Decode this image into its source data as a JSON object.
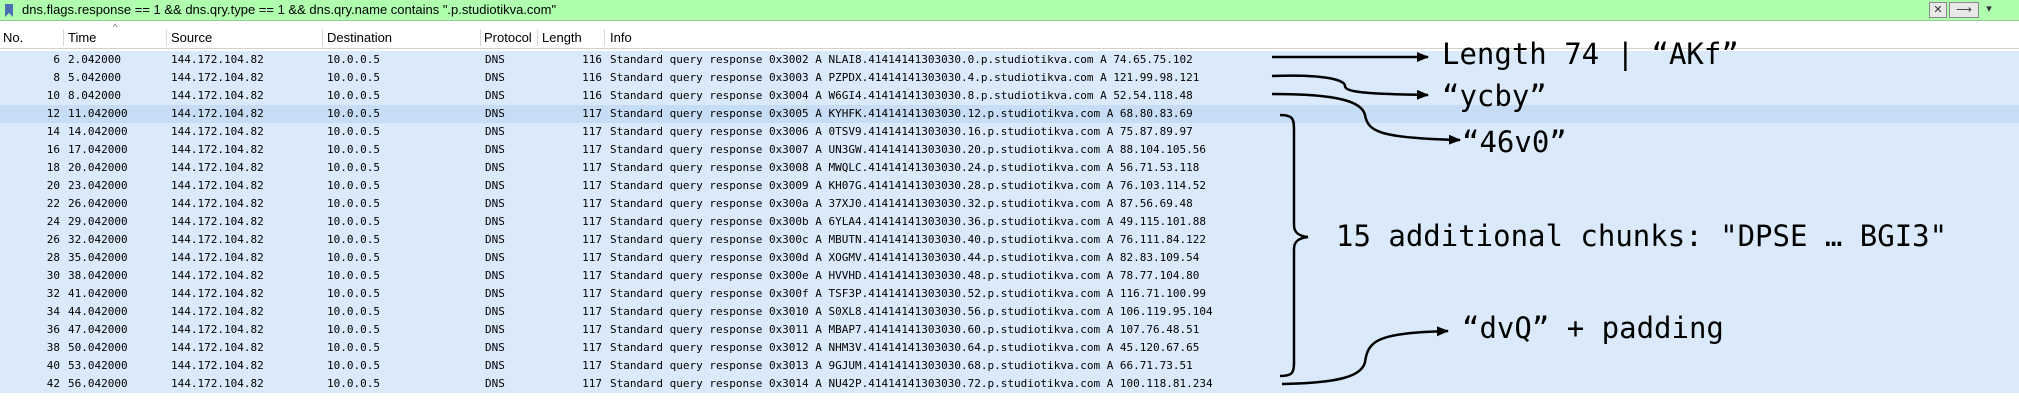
{
  "filter": {
    "text": "dns.flags.response == 1 && dns.qry.type == 1 && dns.qry.name contains \".p.studiotikva.com\"",
    "clear_glyph": "✕",
    "apply_glyph": "⟶",
    "dropdown_glyph": "▾",
    "bookmark_color": "#4a6fb5",
    "background_color": "#afffaf"
  },
  "columns": {
    "no": "No.",
    "time": "Time",
    "source": "Source",
    "destination": "Destination",
    "protocol": "Protocol",
    "length": "Length",
    "info": "Info"
  },
  "sort_indicator": "^",
  "packets": [
    {
      "no": "6",
      "time": "2.042000",
      "src": "144.172.104.82",
      "dst": "10.0.0.5",
      "proto": "DNS",
      "len": "116",
      "info": "Standard query response 0x3002 A NLAI8.41414141303030.0.p.studiotikva.com A 74.65.75.102"
    },
    {
      "no": "8",
      "time": "5.042000",
      "src": "144.172.104.82",
      "dst": "10.0.0.5",
      "proto": "DNS",
      "len": "116",
      "info": "Standard query response 0x3003 A PZPDX.41414141303030.4.p.studiotikva.com A 121.99.98.121"
    },
    {
      "no": "10",
      "time": "8.042000",
      "src": "144.172.104.82",
      "dst": "10.0.0.5",
      "proto": "DNS",
      "len": "116",
      "info": "Standard query response 0x3004 A W6GI4.41414141303030.8.p.studiotikva.com A 52.54.118.48"
    },
    {
      "no": "12",
      "time": "11.042000",
      "src": "144.172.104.82",
      "dst": "10.0.0.5",
      "proto": "DNS",
      "len": "117",
      "info": "Standard query response 0x3005 A KYHFK.41414141303030.12.p.studiotikva.com A 68.80.83.69",
      "selected": true
    },
    {
      "no": "14",
      "time": "14.042000",
      "src": "144.172.104.82",
      "dst": "10.0.0.5",
      "proto": "DNS",
      "len": "117",
      "info": "Standard query response 0x3006 A 0TSV9.41414141303030.16.p.studiotikva.com A 75.87.89.97"
    },
    {
      "no": "16",
      "time": "17.042000",
      "src": "144.172.104.82",
      "dst": "10.0.0.5",
      "proto": "DNS",
      "len": "117",
      "info": "Standard query response 0x3007 A UN3GW.41414141303030.20.p.studiotikva.com A 88.104.105.56"
    },
    {
      "no": "18",
      "time": "20.042000",
      "src": "144.172.104.82",
      "dst": "10.0.0.5",
      "proto": "DNS",
      "len": "117",
      "info": "Standard query response 0x3008 A MWQLC.41414141303030.24.p.studiotikva.com A 56.71.53.118"
    },
    {
      "no": "20",
      "time": "23.042000",
      "src": "144.172.104.82",
      "dst": "10.0.0.5",
      "proto": "DNS",
      "len": "117",
      "info": "Standard query response 0x3009 A KH07G.41414141303030.28.p.studiotikva.com A 76.103.114.52"
    },
    {
      "no": "22",
      "time": "26.042000",
      "src": "144.172.104.82",
      "dst": "10.0.0.5",
      "proto": "DNS",
      "len": "117",
      "info": "Standard query response 0x300a A 37XJ0.41414141303030.32.p.studiotikva.com A 87.56.69.48"
    },
    {
      "no": "24",
      "time": "29.042000",
      "src": "144.172.104.82",
      "dst": "10.0.0.5",
      "proto": "DNS",
      "len": "117",
      "info": "Standard query response 0x300b A 6YLA4.41414141303030.36.p.studiotikva.com A 49.115.101.88"
    },
    {
      "no": "26",
      "time": "32.042000",
      "src": "144.172.104.82",
      "dst": "10.0.0.5",
      "proto": "DNS",
      "len": "117",
      "info": "Standard query response 0x300c A MBUTN.41414141303030.40.p.studiotikva.com A 76.111.84.122"
    },
    {
      "no": "28",
      "time": "35.042000",
      "src": "144.172.104.82",
      "dst": "10.0.0.5",
      "proto": "DNS",
      "len": "117",
      "info": "Standard query response 0x300d A XOGMV.41414141303030.44.p.studiotikva.com A 82.83.109.54"
    },
    {
      "no": "30",
      "time": "38.042000",
      "src": "144.172.104.82",
      "dst": "10.0.0.5",
      "proto": "DNS",
      "len": "117",
      "info": "Standard query response 0x300e A HVVHD.41414141303030.48.p.studiotikva.com A 78.77.104.80"
    },
    {
      "no": "32",
      "time": "41.042000",
      "src": "144.172.104.82",
      "dst": "10.0.0.5",
      "proto": "DNS",
      "len": "117",
      "info": "Standard query response 0x300f A TSF3P.41414141303030.52.p.studiotikva.com A 116.71.100.99"
    },
    {
      "no": "34",
      "time": "44.042000",
      "src": "144.172.104.82",
      "dst": "10.0.0.5",
      "proto": "DNS",
      "len": "117",
      "info": "Standard query response 0x3010 A S0XL8.41414141303030.56.p.studiotikva.com A 106.119.95.104"
    },
    {
      "no": "36",
      "time": "47.042000",
      "src": "144.172.104.82",
      "dst": "10.0.0.5",
      "proto": "DNS",
      "len": "117",
      "info": "Standard query response 0x3011 A MBAP7.41414141303030.60.p.studiotikva.com A 107.76.48.51"
    },
    {
      "no": "38",
      "time": "50.042000",
      "src": "144.172.104.82",
      "dst": "10.0.0.5",
      "proto": "DNS",
      "len": "117",
      "info": "Standard query response 0x3012 A NHM3V.41414141303030.64.p.studiotikva.com A 45.120.67.65"
    },
    {
      "no": "40",
      "time": "53.042000",
      "src": "144.172.104.82",
      "dst": "10.0.0.5",
      "proto": "DNS",
      "len": "117",
      "info": "Standard query response 0x3013 A 9GJUM.41414141303030.68.p.studiotikva.com A 66.71.73.51"
    },
    {
      "no": "42",
      "time": "56.042000",
      "src": "144.172.104.82",
      "dst": "10.0.0.5",
      "proto": "DNS",
      "len": "117",
      "info": "Standard query response 0x3014 A NU42P.41414141303030.72.p.studiotikva.com A 100.118.81.234"
    }
  ],
  "annotations": {
    "first": "Length 74 | “AKf”",
    "second": "“ycby”",
    "third": "“46v0”",
    "chunks": "15 additional chunks: \"DPSE … BGI3\"",
    "last": "“dvQ” + padding"
  },
  "colors": {
    "row_background": "#dbeafb",
    "selected_row": "#c7dcf5",
    "annotation_ink": "#000000"
  }
}
